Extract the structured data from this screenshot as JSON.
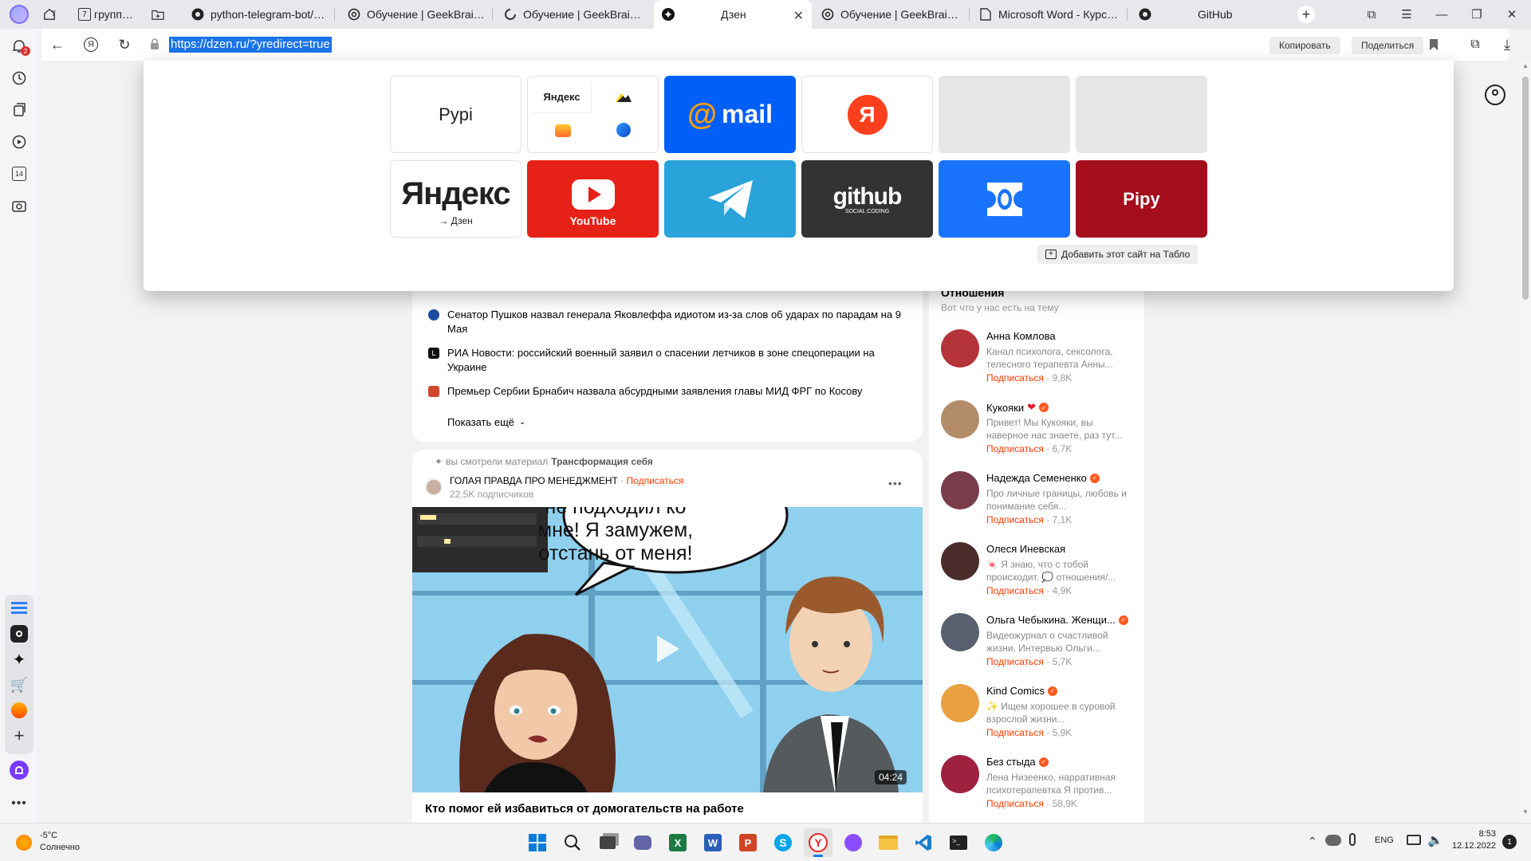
{
  "browser": {
    "tabs": [
      {
        "title": "",
        "count": "7",
        "icon": "home-icon"
      },
      {
        "title": "группа 1",
        "count": "7",
        "icon": "tab-group-icon"
      },
      {
        "title": "python-telegram-bot/conv",
        "icon": "github-icon"
      },
      {
        "title": "Обучение | GeekBrains - о",
        "icon": "openai-icon"
      },
      {
        "title": "Обучение | GeekBrains - о",
        "icon": "loading-icon"
      },
      {
        "title": "Дзен",
        "icon": "dzen-icon"
      },
      {
        "title": "Обучение | GeekBrains - о",
        "icon": "openai-icon"
      },
      {
        "title": "Microsoft Word - Курс_по",
        "icon": "document-icon"
      },
      {
        "title": "GitHub",
        "icon": "github-icon"
      }
    ],
    "url": "https://dzen.ru/?yredirect=true",
    "copy_label": "Копировать",
    "share_label": "Поделиться",
    "notifications_count": "2",
    "sidebar_calendar": "14"
  },
  "speed_dial": {
    "tiles": [
      {
        "label": "Pypi",
        "style": "text"
      },
      {
        "label": "Яндекс",
        "style": "group"
      },
      {
        "label": "mail",
        "style": "mail"
      },
      {
        "label": "Я",
        "style": "yandex-round"
      },
      {
        "label": "",
        "style": "empty"
      },
      {
        "label": "",
        "style": "empty"
      },
      {
        "label": "Яндекс",
        "sublabel": "→ Дзен",
        "style": "yandex-text"
      },
      {
        "label": "YouTube",
        "style": "youtube"
      },
      {
        "label": "",
        "style": "telegram"
      },
      {
        "label": "github",
        "sublabel": "SOCIAL CODING",
        "style": "github"
      },
      {
        "label": "",
        "style": "telemost"
      },
      {
        "label": "Pipy",
        "style": "pipy"
      }
    ],
    "add_site_label": "Добавить этот сайт на Табло"
  },
  "news": {
    "items": [
      {
        "text": "Сенатор Пушков назвал генерала Яковлеффа идиотом из-за слов об ударах по парадам на 9 Мая",
        "source_color": "#1f4fa0"
      },
      {
        "text": "РИА Новости: российский военный заявил о спасении летчиков в зоне спецоперации на Украине",
        "source_color": "#111111"
      },
      {
        "text": "Премьер Сербии Брнабич назвала абсурдными заявления главы МИД ФРГ по Косову",
        "source_color": "#d0472b"
      }
    ],
    "show_more": "Показать ещё"
  },
  "article": {
    "viewed_prefix": "вы смотрели материал",
    "viewed_topic": "Трансформация себя",
    "channel": "ГОЛАЯ ПРАВДА ПРО МЕНЕДЖМЕНТ",
    "subscribe": "Подписаться",
    "subscribers": "22,5K подписчиков",
    "speech_text": "не подходил ко мне! Я замужем, отстань от меня!",
    "duration": "04:24",
    "title": "Кто помог ей избавиться от домогательств на работе"
  },
  "recommend": {
    "title": "Отношения",
    "subtitle": "Вот что у нас есть на тему",
    "authors": [
      {
        "name": "Анна Комлова",
        "desc": "Канал психолога, сексолога, телесного терапевта Анны...",
        "subs": "9,8K",
        "verified": false,
        "heart": false,
        "color": "#b5343a"
      },
      {
        "name": "Кукояки",
        "desc": "Привет! Мы Кукояки, вы наверное нас знаете, раз тут...",
        "subs": "6,7K",
        "verified": true,
        "heart": true,
        "color": "#b38c6a"
      },
      {
        "name": "Надежда Семененко",
        "desc": "Про личные границы, любовь и понимание себя...",
        "subs": "7,1K",
        "verified": true,
        "heart": false,
        "color": "#7a3d4b"
      },
      {
        "name": "Олеся Иневская",
        "desc": "🍬 Я знаю, что с тобой происходит. 💭 отношения/...",
        "subs": "4,9K",
        "verified": false,
        "heart": false,
        "color": "#4a2d2a"
      },
      {
        "name": "Ольга Чебыкина. Женщи...",
        "desc": "Видеожурнал о счастливой жизни. Интервью Ольги...",
        "subs": "5,7K",
        "verified": true,
        "heart": false,
        "color": "#5a6070"
      },
      {
        "name": "Kind Comics",
        "desc": "✨ Ищем хорошее в суровой взрослой жизни...",
        "subs": "5,9K",
        "verified": true,
        "heart": false,
        "color": "#e8a040"
      },
      {
        "name": "Без стыда",
        "desc": "Лена Низеенко, нарративная психотерапевтка Я против...",
        "subs": "58,9K",
        "verified": true,
        "heart": false,
        "color": "#a02040"
      }
    ],
    "subscribe_label": "Подписаться"
  },
  "taskbar": {
    "weather_temp": "-5°C",
    "weather_desc": "Солнечно",
    "lang": "ENG",
    "time": "8:53",
    "date": "12.12.2022",
    "notif_count": "1"
  },
  "colors": {
    "accent_orange": "#ff3c00",
    "mail_blue": "#005ff9",
    "youtube_red": "#e62117",
    "telegram_blue": "#2aa3db",
    "github_dark": "#333333",
    "telemost_blue": "#1a73ff",
    "pipy_red": "#a50e1c"
  }
}
